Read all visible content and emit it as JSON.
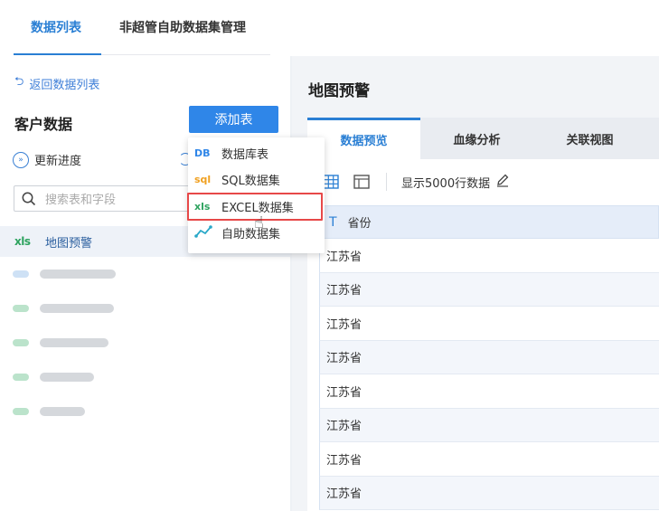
{
  "top_tabs": [
    "数据列表",
    "非超管自助数据集管理"
  ],
  "left": {
    "back_label": "返回数据列表",
    "section_title": "客户数据",
    "add_button": "添加表",
    "update_label": "更新进度",
    "search_placeholder": "搜索表和字段",
    "active_item": "地图预警"
  },
  "add_menu": [
    {
      "icon": "DB",
      "label": "数据库表"
    },
    {
      "icon": "sql",
      "label": "SQL数据集"
    },
    {
      "icon": "xls",
      "label": "EXCEL数据集"
    },
    {
      "icon": "custom",
      "label": "自助数据集"
    }
  ],
  "right": {
    "title": "地图预警",
    "tabs": [
      "数据预览",
      "血缘分析",
      "关联视图"
    ],
    "show_rows_label": "显示5000行数据",
    "column_header": "省份",
    "column_type": "T",
    "rows": [
      "江苏省",
      "江苏省",
      "江苏省",
      "江苏省",
      "江苏省",
      "江苏省",
      "江苏省",
      "江苏省"
    ]
  },
  "colors": {
    "accent": "#2f86e8",
    "highlight": "#e74848",
    "excel_green": "#2ea35f"
  }
}
